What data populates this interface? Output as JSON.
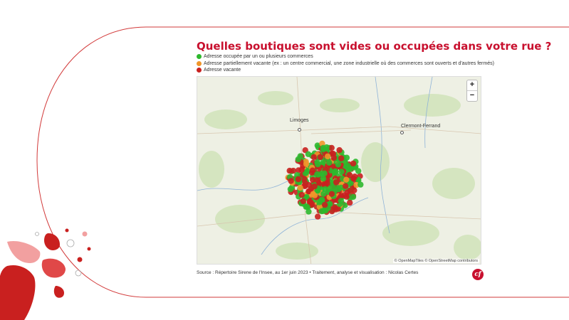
{
  "title": "Quelles boutiques sont vides ou occupées dans votre rue ?",
  "legend": [
    {
      "label": "Adresse occupée par un ou plusieurs commerces",
      "color": "#2db82d"
    },
    {
      "label": "Adresse partiellement vacante (ex : un centre commercial, une zone industrielle où des commerces sont ouverts et d'autres fermés)",
      "color": "#f0962a"
    },
    {
      "label": "Adresse vacante",
      "color": "#c9201f"
    }
  ],
  "map": {
    "zoom_in": "+",
    "zoom_out": "−",
    "cities": [
      "Limoges",
      "Clermont-Ferrand"
    ],
    "attribution": "© OpenMapTiles © OpenStreetMap contributors"
  },
  "source": "Source : Répertoire Sirene de l'Insee, au 1er juin 2023 • Traitement, analyse et visualisation : Nicolas Certes",
  "logo": "cf",
  "colors": {
    "accent": "#c8102e",
    "occupied": "#2db82d",
    "partial": "#f0962a",
    "vacant": "#c9201f"
  }
}
